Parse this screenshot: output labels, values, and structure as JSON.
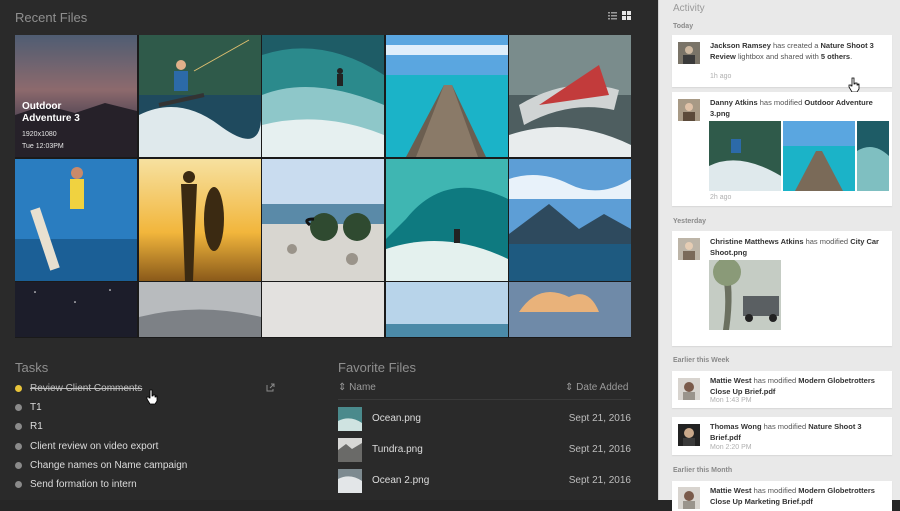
{
  "recent": {
    "title": "Recent Files",
    "view_icons": [
      "list-view-icon",
      "grid-view-icon"
    ],
    "hovered": {
      "title": "Outdoor Adventure 3",
      "dimensions": "1920x1080",
      "time": "Tue 12:03PM"
    }
  },
  "tasks": {
    "title": "Tasks",
    "items": [
      {
        "label": "Review Client Comments",
        "done": true
      },
      {
        "label": "T1",
        "done": false
      },
      {
        "label": "R1",
        "done": false
      },
      {
        "label": "Client review on video export",
        "done": false
      },
      {
        "label": "Change names on Name campaign",
        "done": false
      },
      {
        "label": "Send formation to intern",
        "done": false
      }
    ]
  },
  "favorites": {
    "title": "Favorite Files",
    "col_name": "Name",
    "col_date": "Date Added",
    "rows": [
      {
        "name": "Ocean.png",
        "date": "Sept 21, 2016"
      },
      {
        "name": "Tundra.png",
        "date": "Sept 21, 2016"
      },
      {
        "name": "Ocean 2.png",
        "date": "Sept 21, 2016"
      }
    ]
  },
  "activity": {
    "title": "Activity",
    "groups": [
      "Today",
      "Yesterday",
      "Earlier this Week",
      "Earlier this Month"
    ],
    "cards": [
      {
        "user": "Jackson Ramsey",
        "verb": " has created a ",
        "object": "Nature Shoot 3 Review",
        "tail": " lightbox and shared with ",
        "tail2": "5 others",
        "tail3": ".",
        "ago": "1h ago"
      },
      {
        "user": "Danny Atkins",
        "verb": " has modified ",
        "object": "Outdoor Adventure 3.png",
        "ago": "2h ago"
      },
      {
        "user": "Christine Matthews Atkins",
        "verb": " has modified ",
        "object": "City Car Shoot.png"
      },
      {
        "user": "Mattie West",
        "verb": " has modified ",
        "object": "Modern Globetrotters Close Up Brief.pdf",
        "ago": "Mon 1:43 PM"
      },
      {
        "user": "Thomas Wong",
        "verb": " has modified ",
        "object": "Nature Shoot 3 Brief.pdf",
        "ago": "Mon 2:20 PM"
      },
      {
        "user": "Mattie West",
        "verb": " has modified ",
        "object": "Modern Globetrotters Close Up Marketing Brief.pdf"
      }
    ]
  },
  "colors": {
    "accent": "#e8c43a",
    "panel": "#2a2a2a",
    "sidebar": "#e9e9e9"
  }
}
